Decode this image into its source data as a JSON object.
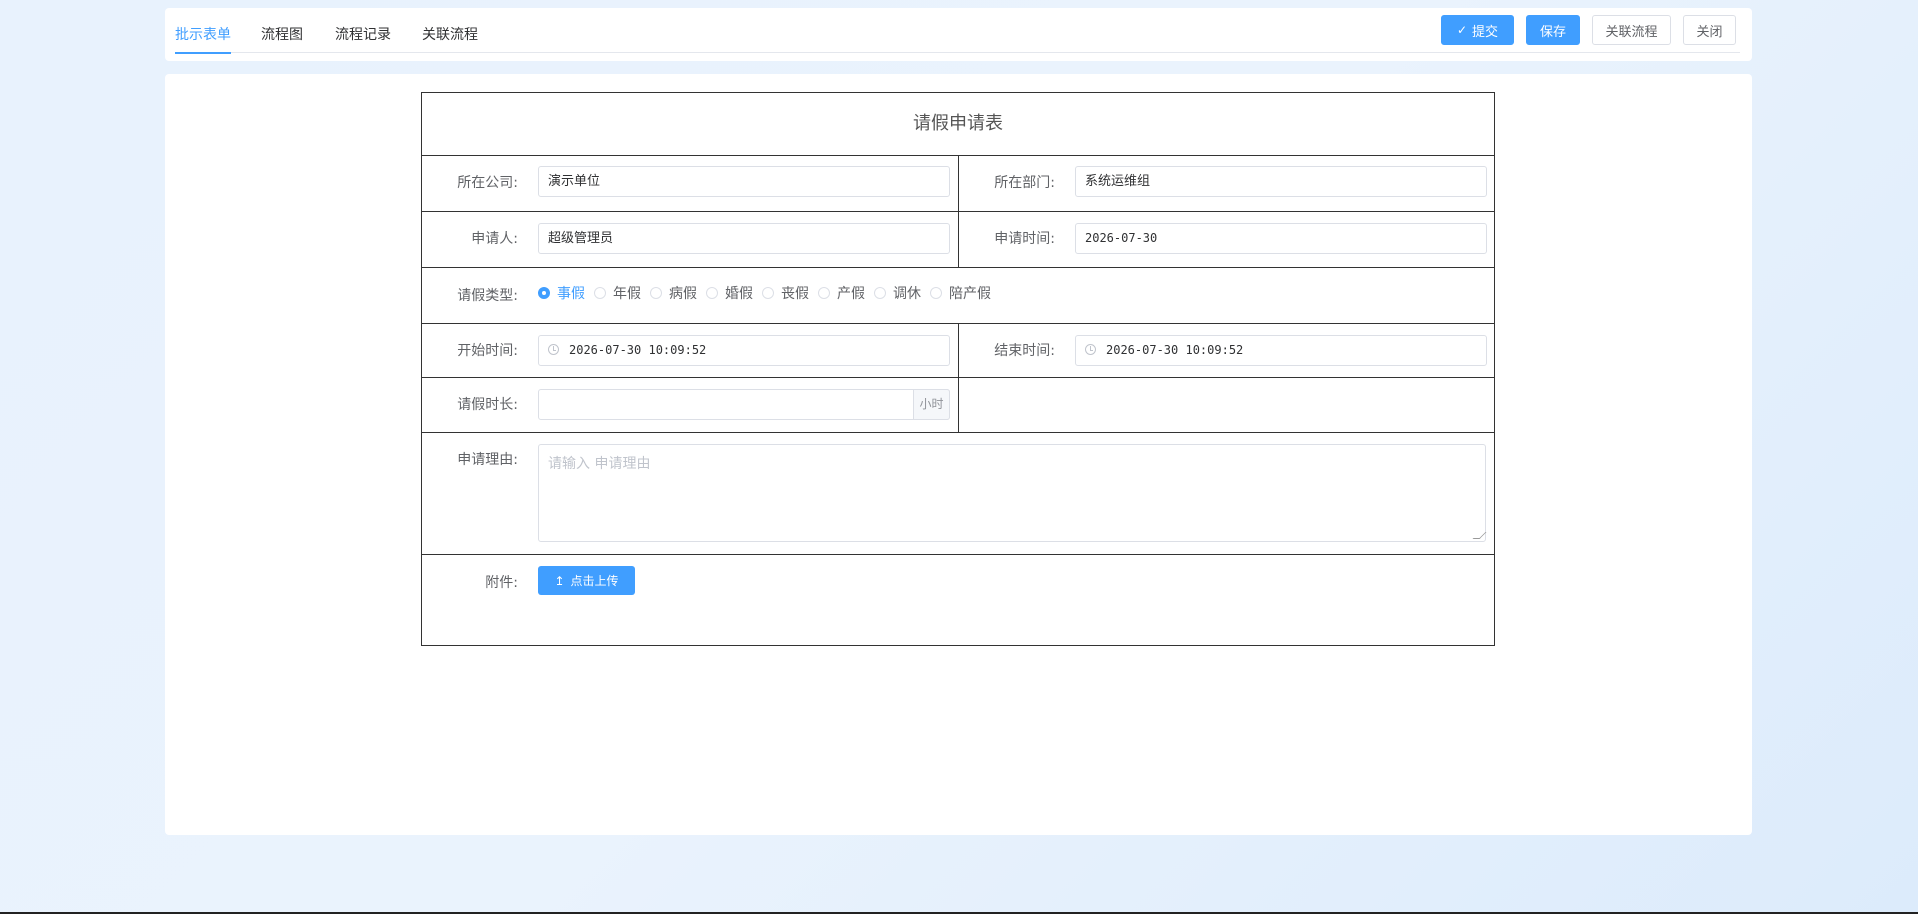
{
  "tabs": [
    {
      "label": "批示表单",
      "active": true
    },
    {
      "label": "流程图",
      "active": false
    },
    {
      "label": "流程记录",
      "active": false
    },
    {
      "label": "关联流程",
      "active": false
    }
  ],
  "toolbar": {
    "submit_label": "提交",
    "save_label": "保存",
    "related_label": "关联流程",
    "close_label": "关闭"
  },
  "form": {
    "title": "请假申请表",
    "company": {
      "label": "所在公司:",
      "value": "演示单位"
    },
    "department": {
      "label": "所在部门:",
      "value": "系统运维组"
    },
    "applicant": {
      "label": "申请人:",
      "value": "超级管理员"
    },
    "apply_time": {
      "label": "申请时间:",
      "value": "2026-07-30"
    },
    "leave_type": {
      "label": "请假类型:",
      "selected": "事假",
      "options": [
        "事假",
        "年假",
        "病假",
        "婚假",
        "丧假",
        "产假",
        "调休",
        "陪产假"
      ]
    },
    "start_time": {
      "label": "开始时间:",
      "value": "2026-07-30 10:09:52"
    },
    "end_time": {
      "label": "结束时间:",
      "value": "2026-07-30 10:09:52"
    },
    "duration": {
      "label": "请假时长:",
      "value": "",
      "unit": "小时"
    },
    "reason": {
      "label": "申请理由:",
      "placeholder": "请输入 申请理由",
      "value": ""
    },
    "attachment": {
      "label": "附件:",
      "upload_label": "点击上传"
    }
  },
  "colors": {
    "accent": "#409eff",
    "border": "#333333",
    "background": "#e8f2fd"
  }
}
